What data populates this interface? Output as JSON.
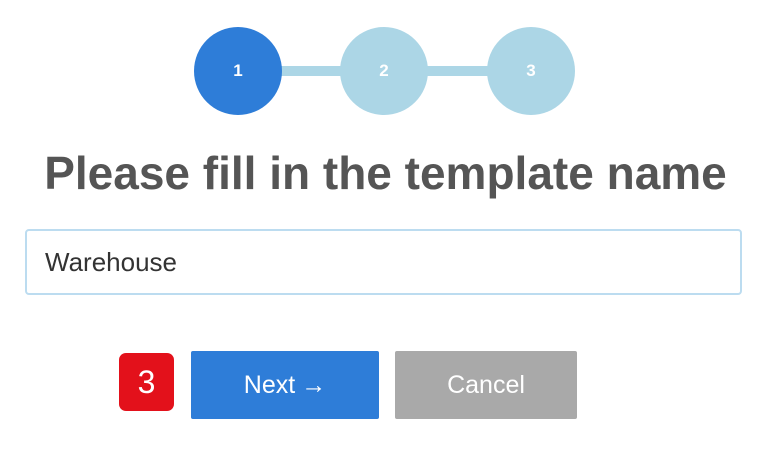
{
  "stepper": {
    "steps": [
      {
        "label": "1",
        "state": "active"
      },
      {
        "label": "2",
        "state": "inactive"
      },
      {
        "label": "3",
        "state": "inactive"
      }
    ],
    "active_color": "#2e7dd8",
    "inactive_color": "#acd6e6"
  },
  "title": "Please fill in the template name",
  "template_name": {
    "value": "Warehouse"
  },
  "annotation": {
    "label": "3",
    "color": "#e3111b"
  },
  "buttons": {
    "next_label": "Next",
    "next_arrow": "→",
    "cancel_label": "Cancel"
  }
}
